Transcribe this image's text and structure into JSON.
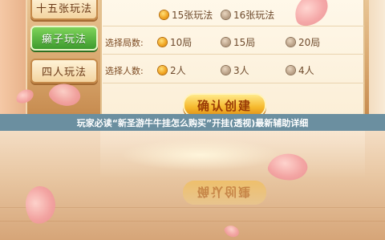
{
  "tabs": [
    {
      "label": "十五张玩法",
      "active": false
    },
    {
      "label": "癞子玩法",
      "active": true
    },
    {
      "label": "四人玩法",
      "active": false
    }
  ],
  "rows": {
    "mode": {
      "options": [
        {
          "label": "15张玩法",
          "selected": true
        },
        {
          "label": "16张玩法",
          "selected": false
        }
      ]
    },
    "rounds": {
      "label": "选择局数:",
      "options": [
        {
          "label": "10局",
          "selected": true
        },
        {
          "label": "15局",
          "selected": false
        },
        {
          "label": "20局",
          "selected": false
        }
      ]
    },
    "players": {
      "label": "选择人数:",
      "options": [
        {
          "label": "2人",
          "selected": true
        },
        {
          "label": "3人",
          "selected": false
        },
        {
          "label": "4人",
          "selected": false
        }
      ]
    }
  },
  "confirm_button": "确认创建",
  "title_bar": "玩家必读“新圣游牛牛挂怎么购买”开挂(透视)最新辅助详细",
  "colors": {
    "accent_green": "#3d9b2e",
    "accent_gold": "#f6b92d",
    "title_bar": "#6b8fa0"
  }
}
